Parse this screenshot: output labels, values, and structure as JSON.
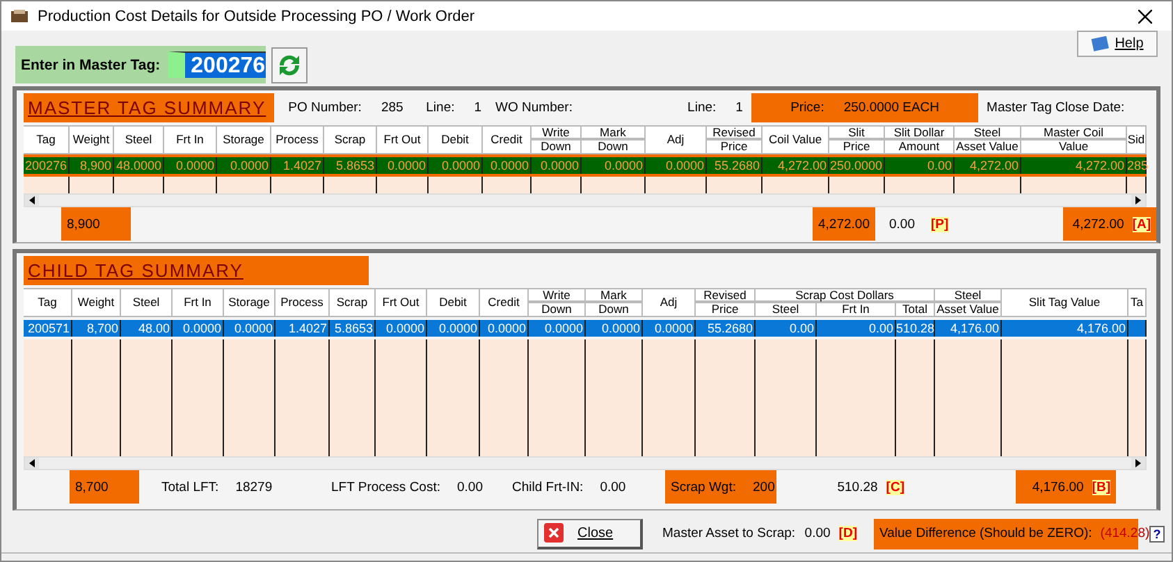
{
  "window": {
    "title": "Production Cost Details for Outside Processing PO / Work Order"
  },
  "help_button": {
    "label": "Help"
  },
  "master_tag_input": {
    "label": "Enter in Master Tag:",
    "value": "200276"
  },
  "master": {
    "title": "MASTER TAG SUMMARY",
    "info": [
      {
        "label": "PO Number:",
        "value": "285",
        "highlighted": false
      },
      {
        "label": "Line:",
        "value": "1",
        "highlighted": false
      },
      {
        "label": "WO Number:",
        "highlighted": false
      },
      {
        "label": "Line:",
        "value": "1",
        "highlighted": false
      },
      {
        "label": "Price:",
        "value": "250.0000  EACH",
        "highlighted": true
      },
      {
        "label": "Master Tag Close Date:",
        "highlighted": false
      }
    ],
    "columns": [
      {
        "kind": "single",
        "label": "Tag"
      },
      {
        "kind": "single",
        "label": "Weight"
      },
      {
        "kind": "single",
        "label": "Steel"
      },
      {
        "kind": "single",
        "label": "Frt In"
      },
      {
        "kind": "single",
        "label": "Storage"
      },
      {
        "kind": "single",
        "label": "Process"
      },
      {
        "kind": "single",
        "label": "Scrap"
      },
      {
        "kind": "single",
        "label": "Frt Out"
      },
      {
        "kind": "single",
        "label": "Debit"
      },
      {
        "kind": "single",
        "label": "Credit"
      },
      {
        "kind": "split",
        "top": "Write",
        "bottom": "Down"
      },
      {
        "kind": "split",
        "top": "Mark",
        "bottom": "Down"
      },
      {
        "kind": "single",
        "label": "Adj"
      },
      {
        "kind": "split",
        "top": "Revised",
        "bottom": "Price"
      },
      {
        "kind": "single",
        "label": "Coil Value"
      },
      {
        "kind": "split",
        "top": "Slit",
        "bottom": "Price"
      },
      {
        "kind": "split",
        "top": "Slit Dollar",
        "bottom": "Amount"
      },
      {
        "kind": "split",
        "top": "Steel",
        "bottom": "Asset Value"
      },
      {
        "kind": "split",
        "top": "Master Coil",
        "bottom": "Value"
      },
      {
        "kind": "single",
        "label": "Sid"
      }
    ],
    "rows": [
      {
        "highlighted": true,
        "cells": [
          "200276",
          "8,900",
          "48.0000",
          "0.0000",
          "0.0000",
          "1.4027",
          "5.8653",
          "0.0000",
          "0.0000",
          "0.0000",
          "0.0000",
          "0.0000",
          "0.0000",
          "55.2680",
          "4,272.00",
          "250.0000",
          "0.00",
          "4,272.00",
          "4,272.00",
          "285"
        ]
      }
    ],
    "totals": [
      {
        "value": "8,900",
        "highlighted": true
      },
      {
        "value": "4,272.00",
        "highlighted": true
      },
      {
        "value": "0.00",
        "highlighted": false
      },
      {
        "tag": "[P]",
        "highlighted": false
      },
      {
        "value": "4,272.00",
        "tag": "[A]",
        "highlighted": true
      }
    ]
  },
  "child": {
    "title": "CHILD TAG SUMMARY",
    "header_groups": [
      {
        "label": "Scrap Cost Dollars"
      }
    ],
    "columns": [
      {
        "kind": "single",
        "label": "Tag"
      },
      {
        "kind": "single",
        "label": "Weight"
      },
      {
        "kind": "single",
        "label": "Steel"
      },
      {
        "kind": "single",
        "label": "Frt In"
      },
      {
        "kind": "single",
        "label": "Storage"
      },
      {
        "kind": "single",
        "label": "Process"
      },
      {
        "kind": "single",
        "label": "Scrap"
      },
      {
        "kind": "single",
        "label": "Frt Out"
      },
      {
        "kind": "single",
        "label": "Debit"
      },
      {
        "kind": "single",
        "label": "Credit"
      },
      {
        "kind": "split",
        "top": "Write",
        "bottom": "Down"
      },
      {
        "kind": "split",
        "top": "Mark",
        "bottom": "Down"
      },
      {
        "kind": "single",
        "label": "Adj"
      },
      {
        "kind": "split",
        "top": "Revised",
        "bottom": "Price"
      },
      {
        "kind": "grouped",
        "label": "Steel"
      },
      {
        "kind": "grouped",
        "label": "Frt In"
      },
      {
        "kind": "grouped",
        "label": "Total"
      },
      {
        "kind": "split",
        "top": "Steel",
        "bottom": "Asset Value"
      },
      {
        "kind": "single",
        "label": "Slit Tag Value"
      },
      {
        "kind": "single",
        "label": "Ta"
      }
    ],
    "rows": [
      {
        "selected": true,
        "cells": [
          "200571",
          "8,700",
          "48.00",
          "0.0000",
          "0.0000",
          "1.4027",
          "5.8653",
          "0.0000",
          "0.0000",
          "0.0000",
          "0.0000",
          "0.0000",
          "0.0000",
          "55.2680",
          "0.00",
          "0.00",
          "510.28",
          "4,176.00",
          "4,176.00"
        ]
      }
    ],
    "totals": [
      {
        "value": "8,700",
        "highlighted": true
      },
      {
        "label": "Total LFT:",
        "value": "18279",
        "highlighted": false
      },
      {
        "label": "LFT Process Cost:",
        "value": "0.00",
        "highlighted": false
      },
      {
        "label": "Child Frt-IN:",
        "value": "0.00",
        "highlighted": false
      },
      {
        "label": "Scrap Wgt:",
        "value": "200",
        "highlighted": true
      },
      {
        "value": "510.28",
        "tag": "[C]",
        "highlighted": false
      },
      {
        "value": "4,176.00",
        "tag": "[B]",
        "highlighted": true
      }
    ]
  },
  "footer": {
    "close_button": {
      "label": "Close"
    },
    "items": [
      {
        "label": "Master Asset to Scrap:",
        "value": "0.00",
        "tag": "[D]",
        "highlighted": false
      },
      {
        "label": "Value Difference (Should be ZERO):",
        "value": "(414.28)",
        "highlighted": true
      }
    ],
    "help_mark": "?"
  }
}
